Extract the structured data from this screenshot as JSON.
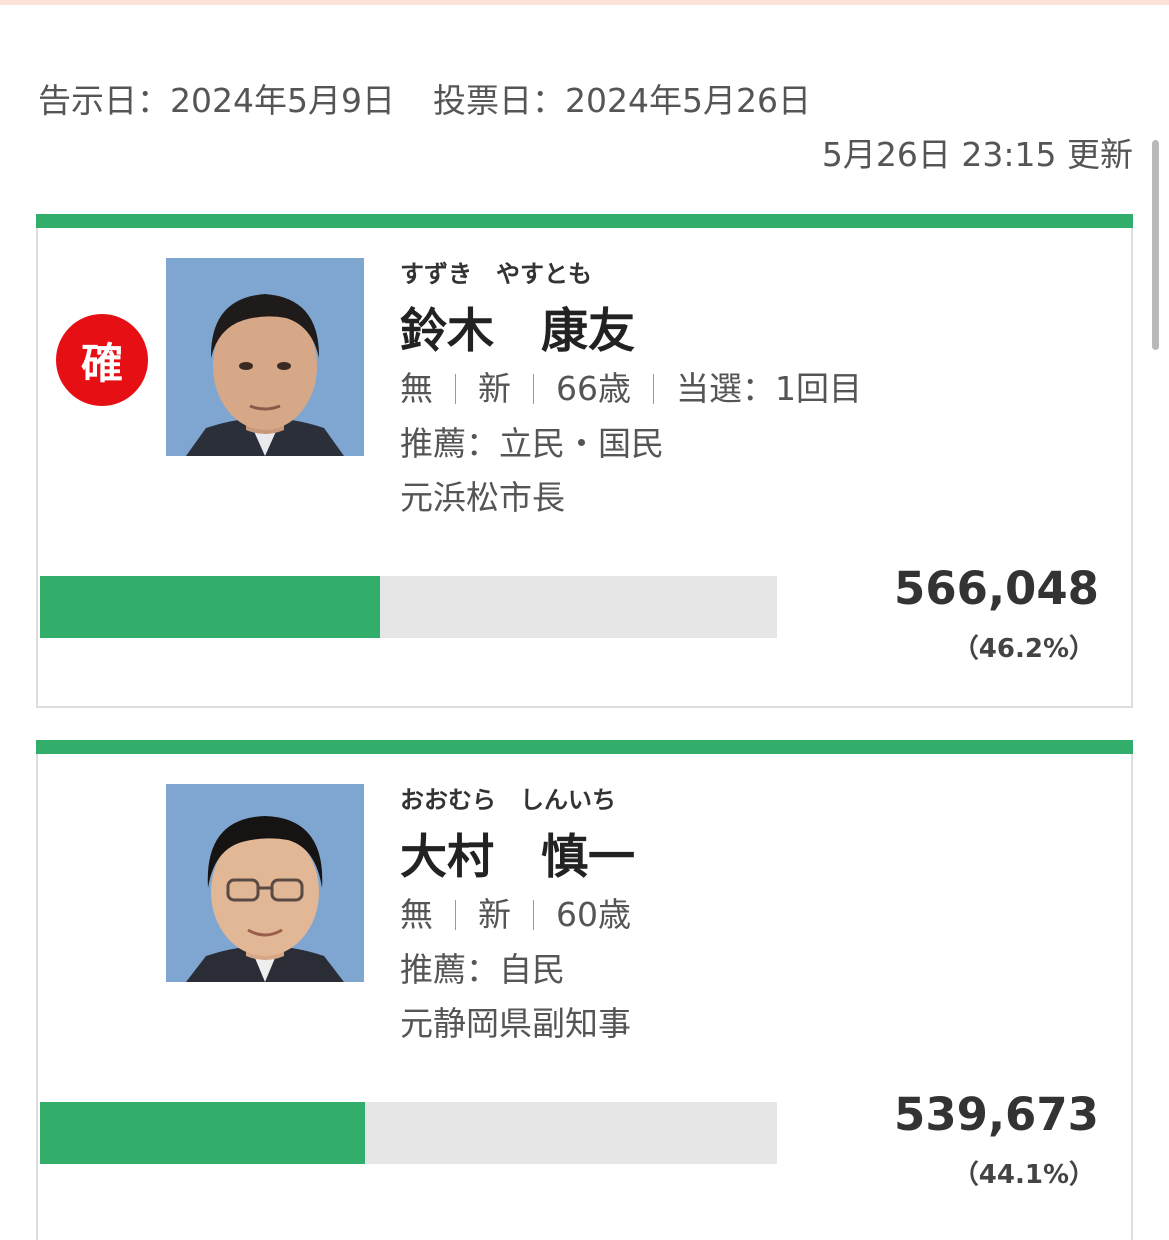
{
  "header": {
    "notice_date": "告示日：2024年5月9日",
    "vote_date": "投票日：2024年5月26日",
    "updated": "5月26日 23:15 更新"
  },
  "colors": {
    "accent": "#33ad6a",
    "elected_badge": "#e60f14",
    "bar_track": "#e6e6e6"
  },
  "candidates": [
    {
      "elected_label": "確",
      "kana": "すずき　やすとも",
      "name": "鈴木　康友",
      "party": "無",
      "status": "新",
      "age": "66歳",
      "wins": "当選：1回目",
      "endorsement": "推薦：立民・国民",
      "career": "元浜松市長",
      "photo_icon": "candidate-photo",
      "votes": "566,048",
      "percent": "（46.2%）",
      "share": 0.462
    },
    {
      "kana": "おおむら　しんいち",
      "name": "大村　慎一",
      "party": "無",
      "status": "新",
      "age": "60歳",
      "endorsement": "推薦：自民",
      "career": "元静岡県副知事",
      "photo_icon": "candidate-photo",
      "votes": "539,673",
      "percent": "（44.1%）",
      "share": 0.441
    }
  ]
}
